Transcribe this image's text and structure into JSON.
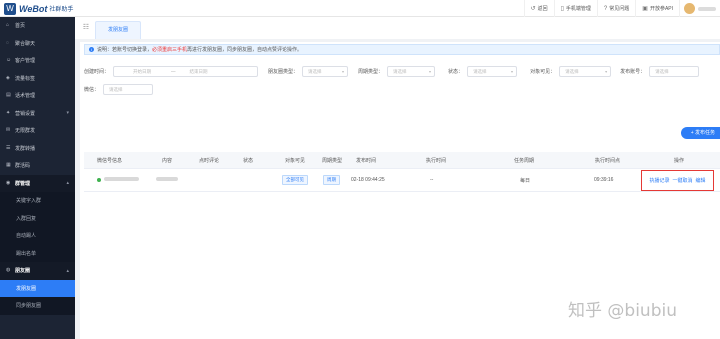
{
  "app": {
    "logo_letter": "W",
    "name": "WeBot",
    "subtitle": "社群助手"
  },
  "topbar": {
    "items": [
      {
        "icon": "back-icon",
        "glyph": "↺",
        "label": "返回"
      },
      {
        "icon": "phone-icon",
        "glyph": "▯",
        "label": "手机端管理"
      },
      {
        "icon": "help-icon",
        "glyph": "?",
        "label": "常见问题"
      },
      {
        "icon": "api-icon",
        "glyph": "▣",
        "label": "开放参API"
      }
    ]
  },
  "sidebar": {
    "items": [
      {
        "icon": "home-icon",
        "glyph": "⌂",
        "label": "首页"
      },
      {
        "icon": "chat-icon",
        "glyph": "◌",
        "label": "聚合聊天"
      },
      {
        "icon": "customer-icon",
        "glyph": "☺",
        "label": "客户管理"
      },
      {
        "icon": "tag-icon",
        "glyph": "◈",
        "label": "流量标签"
      },
      {
        "icon": "script-icon",
        "glyph": "▤",
        "label": "话术管理"
      },
      {
        "icon": "assist-icon",
        "glyph": "✦",
        "label": "营销设置",
        "arrow": "▾"
      },
      {
        "icon": "broadcast-icon",
        "glyph": "✉",
        "label": "无限群发"
      },
      {
        "icon": "plan-icon",
        "glyph": "☰",
        "label": "发群转播"
      },
      {
        "icon": "group-code-icon",
        "glyph": "▦",
        "label": "群活码"
      }
    ],
    "group_management": {
      "icon": "group-icon",
      "glyph": "◉",
      "label": "群管理",
      "arrow": "▴",
      "children": [
        "关键字入群",
        "入群回复",
        "自动踢人",
        "踢出名单"
      ]
    },
    "moments": {
      "icon": "moments-icon",
      "glyph": "◍",
      "label": "朋友圈",
      "arrow": "▴",
      "children": [
        "发朋友圈",
        "同步朋友圈"
      ],
      "active_index": 0
    }
  },
  "tabs": {
    "active": "发朋友圈"
  },
  "notice": {
    "icon_glyph": "i",
    "text_before": "说明：若账号切换登录，",
    "text_red": "必须重启三手机",
    "text_after": "再进行发朋友圈，同步朋友圈，自动点赞评论操作。"
  },
  "filters": {
    "time_label": "创建时间：",
    "start_placeholder": "开始日期",
    "separator": "—",
    "end_placeholder": "结束日期",
    "type_label": "朋友圈类型：",
    "type_placeholder": "请选择",
    "cycle_label": "周期类型：",
    "cycle_placeholder": "请选择",
    "status_label": "状态：",
    "status_placeholder": "请选择",
    "visible_label": "对象可见：",
    "visible_placeholder": "请选择",
    "account_label": "发布账号：",
    "account_placeholder": "请选择",
    "wechat_label": "微信：",
    "wechat_placeholder": "请选择"
  },
  "actions": {
    "add_label": "+ 发布任务"
  },
  "table": {
    "headers": [
      "微信号信息",
      "内容",
      "点时评论",
      "状态",
      "对象可见",
      "周期类型",
      "发布时间",
      "执行时间",
      "任务周期",
      "执行时间点",
      "操作"
    ],
    "rows": [
      {
        "visibility": "全部可见",
        "cycle_type": "周期",
        "publish_time": "02-18 09:44:25",
        "exec_time": "--",
        "task_cycle": "每日",
        "exec_point": "09:39:16",
        "op_record": "执播记录",
        "op_delete": "一键取消",
        "op_edit": "编辑"
      }
    ]
  },
  "watermark": "知乎 @biubiu",
  "colors": {
    "primary": "#2d7df6",
    "sidebar_bg": "#1c2434",
    "highlight_border": "#e53935",
    "notice_red": "#e33333",
    "status_dot": "#3fb24f"
  }
}
